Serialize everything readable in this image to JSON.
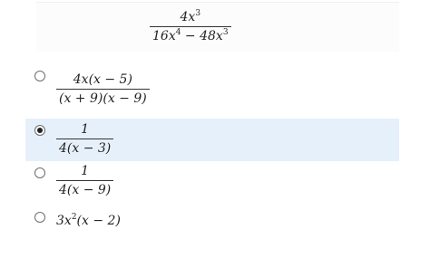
{
  "question": {
    "numerator": "4x",
    "numerator_exp": "3",
    "denominator_a": "16x",
    "denominator_a_exp": "4",
    "denominator_op": " − ",
    "denominator_b": "48x",
    "denominator_b_exp": "3"
  },
  "options": [
    {
      "numerator": "4x(x − 5)",
      "denominator": "(x + 9)(x − 9)",
      "selected": false
    },
    {
      "numerator": "1",
      "denominator": "4(x − 3)",
      "selected": true
    },
    {
      "numerator": "1",
      "denominator": "4(x − 9)",
      "selected": false
    },
    {
      "expr_pre": "3x",
      "expr_exp": "2",
      "expr_post": "(x − 2)",
      "selected": false
    }
  ],
  "colors": {
    "selected_bg": "#e6f0fb",
    "radio_border": "#6d6d6d"
  }
}
